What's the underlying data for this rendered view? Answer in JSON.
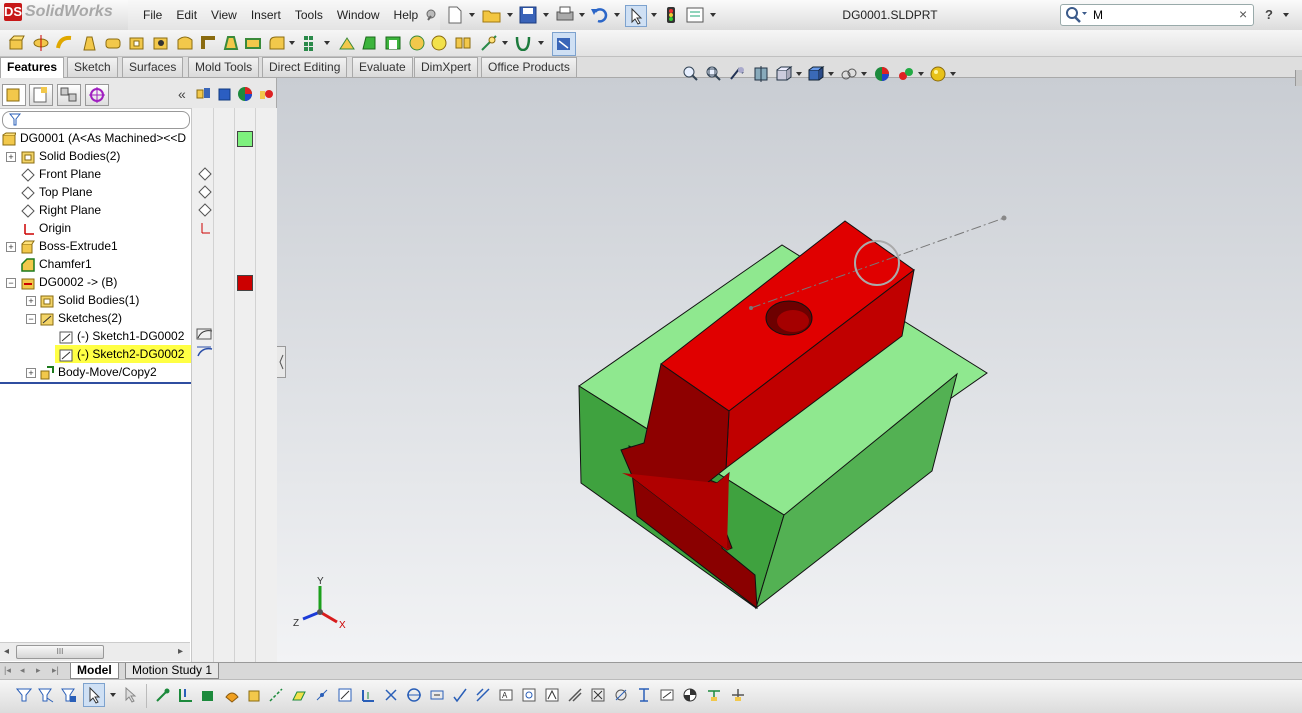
{
  "app": {
    "logo_text": "SolidWorks",
    "logo_mark": "DS"
  },
  "menu": [
    "File",
    "Edit",
    "View",
    "Insert",
    "Tools",
    "Window",
    "Help"
  ],
  "document_title": "DG0001.SLDPRT",
  "search": {
    "value": "M",
    "clear": "×"
  },
  "help_label": "?",
  "command_tabs": [
    "Features",
    "Sketch",
    "Surfaces",
    "Mold Tools",
    "Direct Editing",
    "Evaluate",
    "DimXpert",
    "Office Products"
  ],
  "tree": {
    "collapse_label": "«",
    "items": [
      {
        "label": "DG0001  (A<As Machined><<D"
      },
      {
        "label": "Solid Bodies(2)"
      },
      {
        "label": "Front Plane"
      },
      {
        "label": "Top Plane"
      },
      {
        "label": "Right Plane"
      },
      {
        "label": "Origin"
      },
      {
        "label": "Boss-Extrude1"
      },
      {
        "label": "Chamfer1"
      },
      {
        "label": "DG0002 -> (B)"
      },
      {
        "label": "Solid Bodies(1)"
      },
      {
        "label": "Sketches(2)"
      },
      {
        "label": "(-) Sketch1-DG0002"
      },
      {
        "label": "(-) Sketch2-DG0002"
      },
      {
        "label": "Body-Move/Copy2"
      }
    ]
  },
  "display_colors": {
    "body1": "#7ef07e",
    "body2": "#cc0000"
  },
  "scroll_grip": "III",
  "bottom_tabs": [
    "Model",
    "Motion Study 1"
  ],
  "triad": {
    "x": "X",
    "y": "Y",
    "z": "Z"
  }
}
